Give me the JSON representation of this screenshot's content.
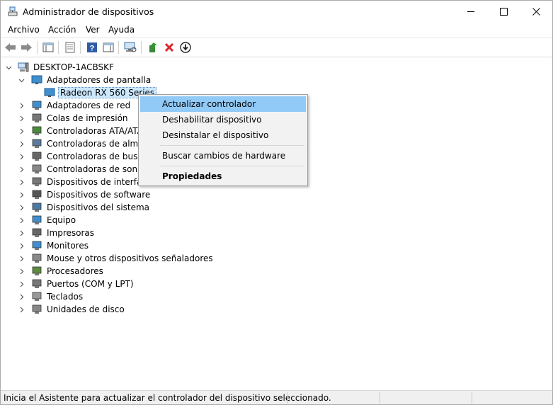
{
  "window": {
    "title": "Administrador de dispositivos"
  },
  "menu": [
    "Archivo",
    "Acción",
    "Ver",
    "Ayuda"
  ],
  "toolbar": {
    "icons": [
      "back-icon",
      "forward-icon",
      "properties-pane-icon",
      "show-hidden-icon",
      "help-icon",
      "action-pane-icon",
      "scan-hardware-icon",
      "update-driver-icon",
      "uninstall-device-icon",
      "download-icon"
    ]
  },
  "tree": {
    "root": "DESKTOP-1ACBSKF",
    "expanded_category": "Adaptadores de pantalla",
    "selected_device": "Radeon RX 560 Series",
    "categories": [
      "Adaptadores de red",
      "Colas de impresión",
      "Controladoras ATA/ATAPI",
      "Controladoras de almacenamiento",
      "Controladoras de bus serie universal",
      "Controladoras de sonido y vídeo y dispositivos de juego",
      "Dispositivos de interfaz de usuario (HID)",
      "Dispositivos de software",
      "Dispositivos del sistema",
      "Equipo",
      "Impresoras",
      "Monitores",
      "Mouse y otros dispositivos señaladores",
      "Procesadores",
      "Puertos (COM y LPT)",
      "Teclados",
      "Unidades de disco"
    ]
  },
  "context_menu": {
    "update_driver": "Actualizar controlador",
    "disable_device": "Deshabilitar dispositivo",
    "uninstall_device": "Desinstalar el dispositivo",
    "scan_hardware": "Buscar cambios de hardware",
    "properties": "Propiedades"
  },
  "status_bar": {
    "text": "Inicia el Asistente para actualizar el controlador del dispositivo seleccionado."
  },
  "colors": {
    "menu_highlight": "#91c9f7",
    "selection": "#cce8ff",
    "close_red": "#d9262c",
    "help_blue": "#2f5ca8"
  }
}
